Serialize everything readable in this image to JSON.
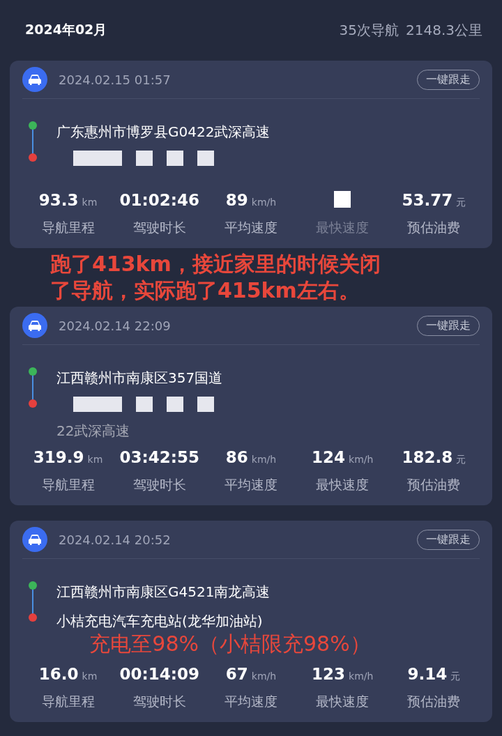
{
  "header": {
    "month": "2024年02月",
    "trip_count": "35次导航",
    "total_distance": "2148.3公里"
  },
  "trips": [
    {
      "datetime": "2024.02.15 01:57",
      "follow_button": "一键跟走",
      "start": "广东惠州市博罗县G0422武深高速",
      "end": {
        "redacted": true
      },
      "stats": [
        {
          "value": "93.3",
          "unit": "km",
          "label": "导航里程",
          "redacted": false
        },
        {
          "value": "01:02:46",
          "label": "驾驶时长",
          "redacted": false
        },
        {
          "value": "89",
          "unit": "km/h",
          "label": "平均速度",
          "redacted": false
        },
        {
          "label": "最快速度",
          "redacted": true
        },
        {
          "value": "53.77",
          "unit": "元",
          "label": "预估油费",
          "redacted": false
        }
      ]
    },
    {
      "datetime": "2024.02.14 22:09",
      "follow_button": "一键跟走",
      "start": "江西赣州市南康区357国道",
      "end": {
        "redacted": true,
        "text": "22武深高速"
      },
      "annotation": {
        "kind": "above",
        "lines": [
          "跑了413km，接近家里的时候关闭",
          "了导航，实际跑了415km左右。"
        ]
      },
      "stats": [
        {
          "value": "319.9",
          "unit": "km",
          "label": "导航里程",
          "redacted": false
        },
        {
          "value": "03:42:55",
          "label": "驾驶时长",
          "redacted": false
        },
        {
          "value": "86",
          "unit": "km/h",
          "label": "平均速度",
          "redacted": false
        },
        {
          "value": "124",
          "unit": "km/h",
          "label": "最快速度",
          "redacted": false
        },
        {
          "value": "182.8",
          "unit": "元",
          "label": "预估油费",
          "redacted": false
        }
      ]
    },
    {
      "datetime": "2024.02.14 20:52",
      "follow_button": "一键跟走",
      "start": "江西赣州市南康区G4521南龙高速",
      "end": {
        "redacted": false,
        "text": "小桔充电汽车充电站(龙华加油站)"
      },
      "annotation": {
        "kind": "inline",
        "lines": [
          "充电至98%（小桔限充98%）"
        ]
      },
      "stats": [
        {
          "value": "16.0",
          "unit": "km",
          "label": "导航里程",
          "redacted": false
        },
        {
          "value": "00:14:09",
          "label": "驾驶时长",
          "redacted": false
        },
        {
          "value": "67",
          "unit": "km/h",
          "label": "平均速度",
          "redacted": false
        },
        {
          "value": "123",
          "unit": "km/h",
          "label": "最快速度",
          "redacted": false
        },
        {
          "value": "9.14",
          "unit": "元",
          "label": "预估油费",
          "redacted": false
        }
      ]
    }
  ]
}
